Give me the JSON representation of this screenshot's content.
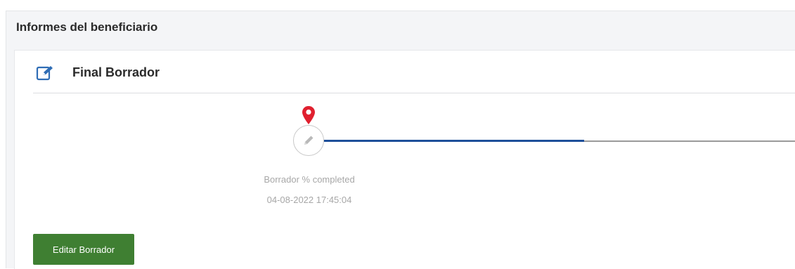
{
  "section": {
    "title": "Informes del beneficiario"
  },
  "card": {
    "title": "Final Borrador",
    "title_icon": "edit-icon"
  },
  "timeline": {
    "progress": 0.55,
    "node_icon": "pencil-icon",
    "marker_icon": "location-pin-icon",
    "status_label": "Borrador % completed",
    "timestamp": "04-08-2022 17:45:04",
    "colors": {
      "done": "#1e4f9a",
      "remaining": "#9a9a9a",
      "marker": "#e0202f"
    }
  },
  "actions": {
    "edit_label": "Editar Borrador",
    "edit_color": "#3f7f32"
  }
}
